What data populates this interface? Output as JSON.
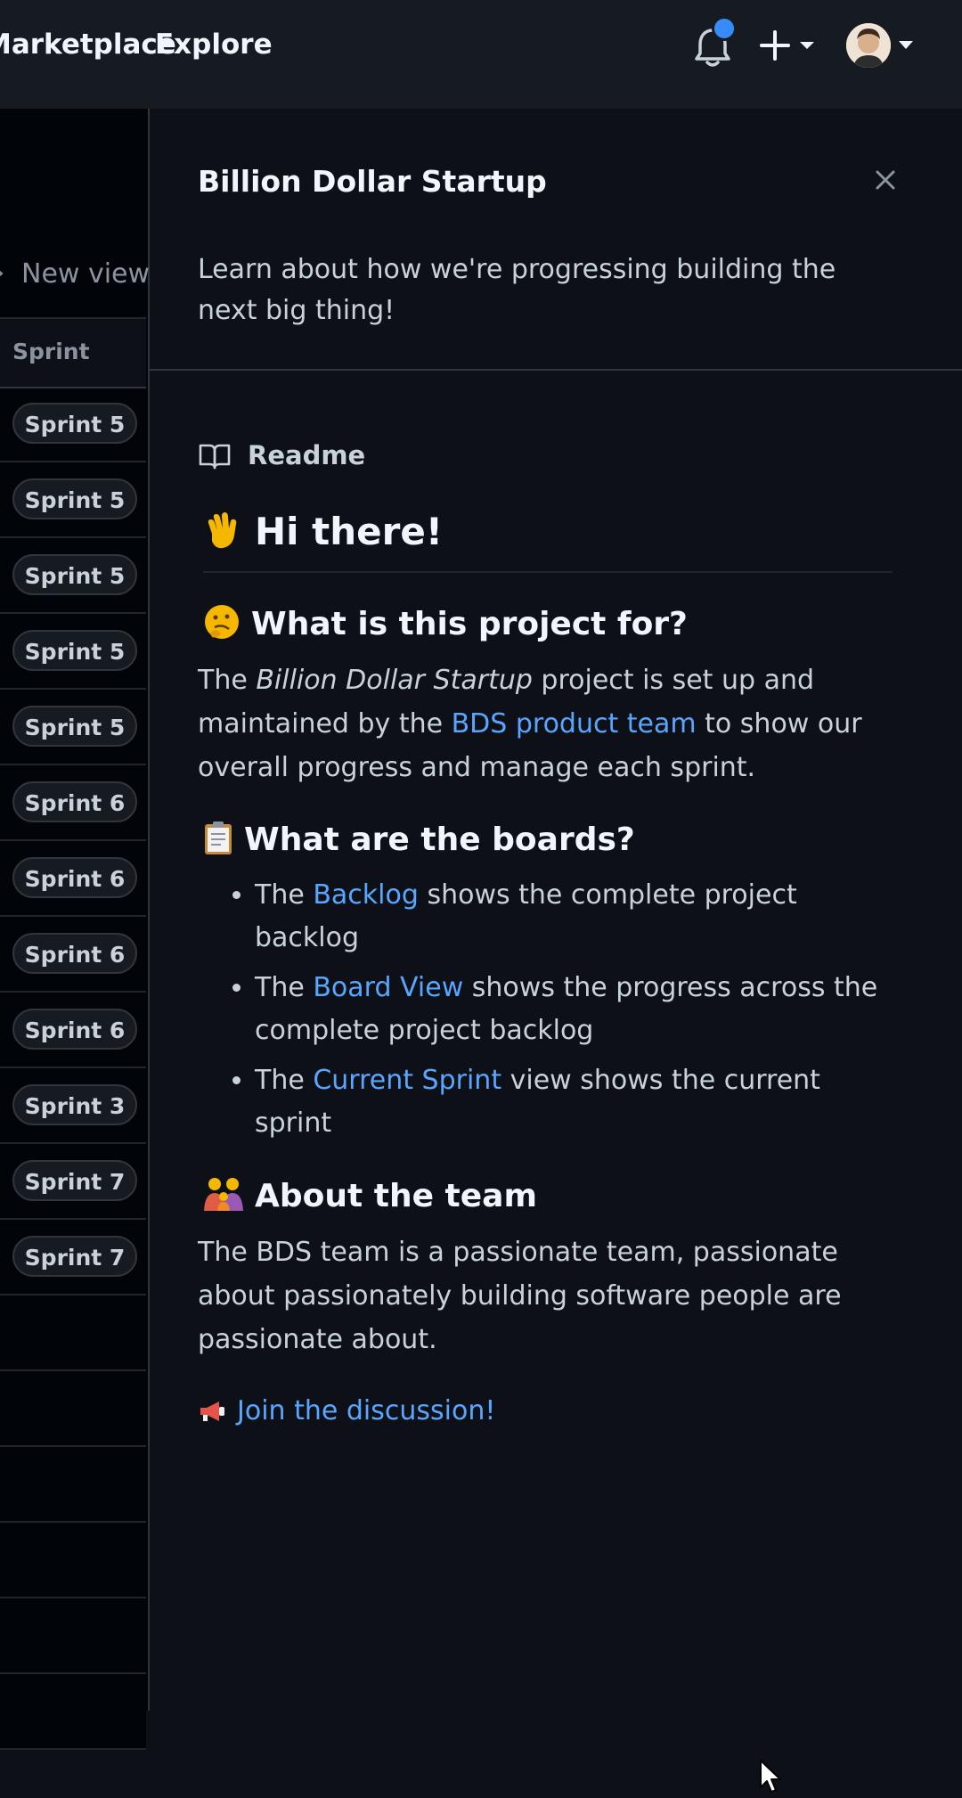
{
  "header": {
    "nav": [
      "Marketplace",
      "Explore"
    ],
    "notification_dot_color": "#388bfd"
  },
  "table": {
    "new_view_label": "New view",
    "column_header": "Sprint",
    "rows": [
      "Sprint 5",
      "Sprint 5",
      "Sprint 5",
      "Sprint 5",
      "Sprint 5",
      "Sprint 6",
      "Sprint 6",
      "Sprint 6",
      "Sprint 6",
      "Sprint 3",
      "Sprint 7",
      "Sprint 7"
    ]
  },
  "panel": {
    "title": "Billion Dollar Startup",
    "description": "Learn about how we're progressing building the next big thing!",
    "readme_label": "Readme",
    "h1": "Hi there!",
    "h2_what": "What is this project for?",
    "what_p_before_em": "The ",
    "what_em": "Billion Dollar Startup",
    "what_p_mid": " project is set up and maintained by the ",
    "what_link": "BDS product team",
    "what_p_after": " to show our overall progress and manage each sprint.",
    "h2_boards": "What are the boards?",
    "boards": [
      {
        "pre": "The ",
        "link": "Backlog",
        "post": " shows the complete project backlog"
      },
      {
        "pre": "The ",
        "link": "Board View",
        "post": " shows the progress across the complete project backlog"
      },
      {
        "pre": "The ",
        "link": "Current Sprint",
        "post": " view shows the current sprint"
      }
    ],
    "h2_team": "About the team",
    "team_p": "The BDS team is a passionate team, passionate about passionately building software people are passionate about.",
    "join_link": "Join the discussion!"
  },
  "colors": {
    "background": "#0d1117",
    "header": "#161b22",
    "link": "#58a6ff"
  }
}
